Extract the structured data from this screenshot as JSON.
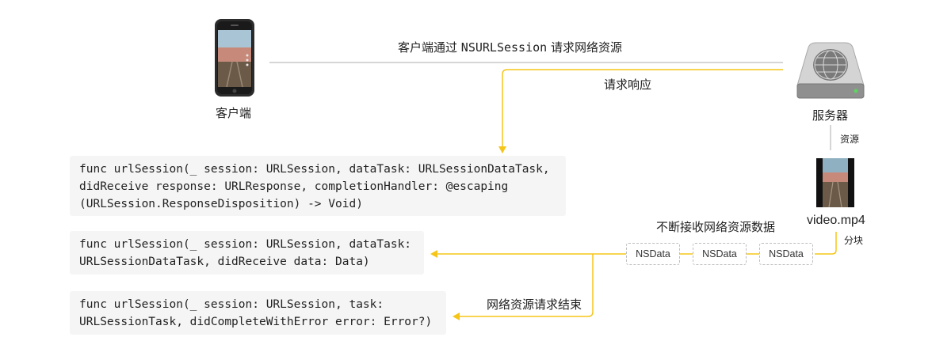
{
  "nodes": {
    "client_label": "客户端",
    "server_label": "服务器",
    "video_label": "video.mp4"
  },
  "edges": {
    "request_prefix": "客户端通过",
    "request_api": "NSURLSession",
    "request_suffix": "请求网络资源",
    "response": "请求响应",
    "resource": "资源",
    "chunk": "分块",
    "receive_data": "不断接收网络资源数据",
    "finish": "网络资源请求结束"
  },
  "chunks": [
    "NSData",
    "NSData",
    "NSData"
  ],
  "code_blocks": [
    [
      "func urlSession(_ session: URLSession, dataTask: URLSessionDataTask,",
      "didReceive response: URLResponse, completionHandler: @escaping",
      "(URLSession.ResponseDisposition) -> Void)"
    ],
    [
      "func urlSession(_ session: URLSession, dataTask:",
      "URLSessionDataTask, didReceive data: Data)"
    ],
    [
      "func urlSession(_ session: URLSession, task:",
      "URLSessionTask, didCompleteWithError error: Error?)"
    ]
  ],
  "colors": {
    "arrow": "#F5C518",
    "line": "#c8c8c8",
    "code_bg": "#f5f5f5"
  }
}
